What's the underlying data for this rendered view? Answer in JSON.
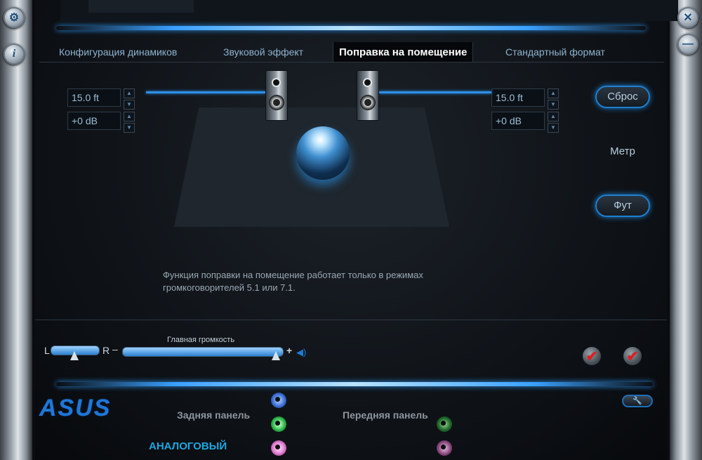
{
  "tabs": [
    {
      "label": "Конфигурация динамиков",
      "active": false
    },
    {
      "label": "Звуковой эффект",
      "active": false
    },
    {
      "label": "Поправка на помещение",
      "active": true
    },
    {
      "label": "Стандартный формат",
      "active": false
    }
  ],
  "left_speaker": {
    "distance": "15.0 ft",
    "gain": "+0 dB"
  },
  "right_speaker": {
    "distance": "15.0 ft",
    "gain": "+0 dB"
  },
  "buttons": {
    "reset": "Сброс",
    "meter": "Метр",
    "foot": "Фут"
  },
  "info_text_line1": "Функция поправки на помещение работает только в режимах",
  "info_text_line2": "громкоговорителей 5.1 или 7.1.",
  "balance": {
    "left_label": "L",
    "right_label": "R",
    "minus": "–",
    "position": 0.5
  },
  "volume": {
    "title": "Главная громкость",
    "plus": "+",
    "level": 0.96
  },
  "brand": "ASUS",
  "rear_panel_label": "Задняя панель",
  "front_panel_label": "Передняя панель",
  "analog_label": "АНАЛОГОВЫЙ",
  "colors": {
    "accent": "#2d8fe6",
    "jack_blue": "#3b6fd8",
    "jack_green": "#2fb84a",
    "jack_pink": "#e07ad0",
    "check_red": "#e01d1d"
  },
  "icons": {
    "top_left": "gear-icon",
    "left_second": "info-icon",
    "top_right": "close-icon",
    "right_second": "minimize-icon",
    "wrench": "wrench-icon",
    "speaker": "speaker-icon",
    "volume": "volume-icon"
  }
}
